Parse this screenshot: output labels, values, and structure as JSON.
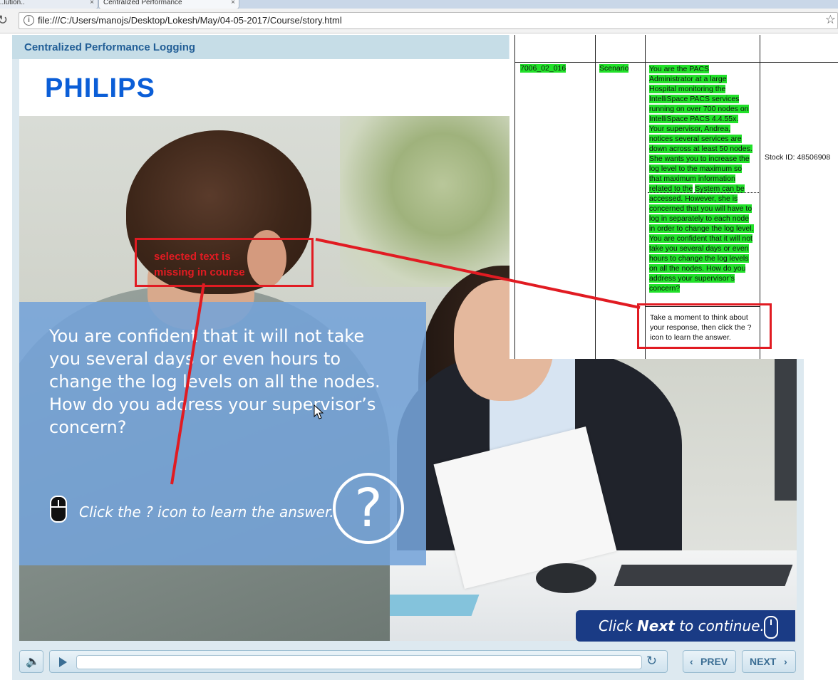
{
  "browser": {
    "tabs": [
      {
        "label": "...lution.."
      },
      {
        "label": "Centralized Performance"
      }
    ],
    "url": "file:///C:/Users/manojs/Desktop/Lokesh/May/04-05-2017/Course/story.html"
  },
  "course": {
    "title": "Centralized Performance Logging",
    "logo": "PHILIPS",
    "question": "You are confident that it will not take you several days or even hours to change the log levels on all the nodes. How do you address your supervisor’s concern?",
    "hint": "Click the ? icon to learn the answer.",
    "help_symbol": "?",
    "next_banner": {
      "prefix": "Click ",
      "emphasis": "Next",
      "suffix": " to continue."
    },
    "controls": {
      "prev": "PREV",
      "next": "NEXT",
      "progress": 0
    }
  },
  "document": {
    "row_id": "7006_02_016",
    "row_type": "Scenario",
    "scenario_part1": "You are the PACS Administrator at a large Hospital monitoring the IntelliSpace PACS services running on over 700 nodes on IntelliSpace PACS 4.4.55x. Your supervisor, Andrea, notices several services are down across at least 50 nodes. She wants you to increase the log level to the maximum so that maximum information related to the",
    "scenario_part2": "System can be accessed. However, she is concerned that you will have to log in separately to each node in order to change the log level. You are confident that it will not take you several days or even hours to change the log levels on all the nodes. How do you address your supervisor’s concern?",
    "stock_id": "Stock ID: 48506908",
    "prompt": "Take a moment to think about your response, then click the ? icon to learn the answer."
  },
  "annotation": {
    "note": "selected text is missing in course",
    "color": "#e11b22"
  },
  "colors": {
    "title_bar": "#c6dde7",
    "title_text": "#235f97",
    "philips_blue": "#0b5ed7",
    "question_panel": "#74a3d8",
    "next_banner": "#1a3b85",
    "highlight": "#22e12a"
  },
  "icons": [
    "info-icon",
    "star-icon",
    "reload-icon",
    "mouse-icon",
    "help-icon",
    "volume-icon",
    "play-icon",
    "replay-icon",
    "chevron-left-icon",
    "chevron-right-icon"
  ]
}
